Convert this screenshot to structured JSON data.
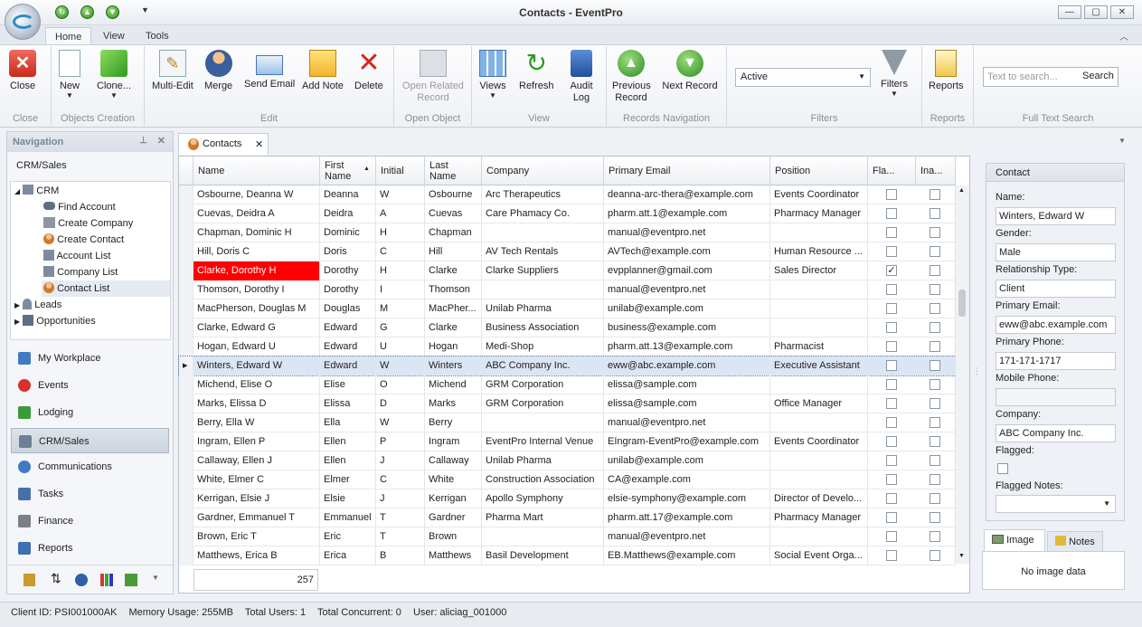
{
  "window": {
    "title": "Contacts - EventPro"
  },
  "ribbon": {
    "tabs": [
      "Home",
      "View",
      "Tools"
    ],
    "groups": [
      {
        "label": "Close",
        "buttons": [
          "Close"
        ]
      },
      {
        "label": "Objects Creation",
        "buttons": [
          "New",
          "Clone..."
        ]
      },
      {
        "label": "Edit",
        "buttons": [
          "Multi-Edit",
          "Merge",
          "Send Email",
          "Add Note",
          "Delete"
        ]
      },
      {
        "label": "Open Object",
        "buttons": [
          "Open Related Record"
        ]
      },
      {
        "label": "View",
        "buttons": [
          "Views",
          "Refresh",
          "Audit Log"
        ]
      },
      {
        "label": "Records Navigation",
        "buttons": [
          "Previous Record",
          "Next Record"
        ]
      },
      {
        "label": "Filters",
        "buttons": [
          "Filters"
        ]
      },
      {
        "label": "Reports",
        "buttons": [
          "Reports"
        ]
      },
      {
        "label": "Full Text Search",
        "buttons": [
          "Search"
        ]
      }
    ],
    "filter_value": "Active",
    "search_placeholder": "Text to search...",
    "search_button": "Search"
  },
  "nav": {
    "header": "Navigation",
    "section": "CRM/Sales",
    "tree": {
      "root": "CRM",
      "children": [
        "Find Account",
        "Create Company",
        "Create Contact",
        "Account List",
        "Company List",
        "Contact List"
      ],
      "others": [
        "Leads",
        "Opportunities"
      ]
    },
    "modules": [
      "My Workplace",
      "Events",
      "Lodging",
      "CRM/Sales",
      "Communications",
      "Tasks",
      "Finance",
      "Reports"
    ],
    "selected_module": "CRM/Sales"
  },
  "doc_tab": "Contacts",
  "grid": {
    "columns": [
      "Name",
      "First Name",
      "Initial",
      "Last Name",
      "Company",
      "Primary Email",
      "Position",
      "Fla...",
      "Ina..."
    ],
    "rows": [
      [
        "Osbourne, Deanna W",
        "Deanna",
        "W",
        "Osbourne",
        "Arc Therapeutics",
        "deanna-arc-thera@example.com",
        "Events Coordinator",
        false
      ],
      [
        "Cuevas, Deidra A",
        "Deidra",
        "A",
        "Cuevas",
        "Care Phamacy Co.",
        "pharm.att.1@example.com",
        "Pharmacy Manager",
        false
      ],
      [
        "Chapman, Dominic H",
        "Dominic",
        "H",
        "Chapman",
        "",
        "manual@eventpro.net",
        "",
        false
      ],
      [
        "Hill, Doris C",
        "Doris",
        "C",
        "Hill",
        "AV Tech Rentals",
        "AVTech@example.com",
        "Human Resource ...",
        false
      ],
      [
        "Clarke, Dorothy H",
        "Dorothy",
        "H",
        "Clarke",
        "Clarke Suppliers",
        "evpplanner@gmail.com",
        "Sales Director",
        true
      ],
      [
        "Thomson, Dorothy I",
        "Dorothy",
        "I",
        "Thomson",
        "",
        "manual@eventpro.net",
        "",
        false
      ],
      [
        "MacPherson, Douglas M",
        "Douglas",
        "M",
        "MacPher...",
        "Unilab Pharma",
        "unilab@example.com",
        "",
        false
      ],
      [
        "Clarke, Edward G",
        "Edward",
        "G",
        "Clarke",
        "Business Association",
        "business@example.com",
        "",
        false
      ],
      [
        "Hogan, Edward U",
        "Edward",
        "U",
        "Hogan",
        "Medi-Shop",
        "pharm.att.13@example.com",
        "Pharmacist",
        false
      ],
      [
        "Winters, Edward W",
        "Edward",
        "W",
        "Winters",
        "ABC Company Inc.",
        "eww@abc.example.com",
        "Executive Assistant",
        false
      ],
      [
        "Michend, Elise O",
        "Elise",
        "O",
        "Michend",
        "GRM Corporation",
        "elissa@sample.com",
        "",
        false
      ],
      [
        "Marks, Elissa D",
        "Elissa",
        "D",
        "Marks",
        "GRM Corporation",
        "elissa@sample.com",
        "Office Manager",
        false
      ],
      [
        "Berry, Ella W",
        "Ella",
        "W",
        "Berry",
        "",
        "manual@eventpro.net",
        "",
        false
      ],
      [
        "Ingram, Ellen P",
        "Ellen",
        "P",
        "Ingram",
        "EventPro Internal Venue",
        "EIngram-EventPro@example.com",
        "Events Coordinator",
        false
      ],
      [
        "Callaway, Ellen J",
        "Ellen",
        "J",
        "Callaway",
        "Unilab Pharma",
        "unilab@example.com",
        "",
        false
      ],
      [
        "White, Elmer C",
        "Elmer",
        "C",
        "White",
        "Construction Association",
        "CA@example.com",
        "",
        false
      ],
      [
        "Kerrigan, Elsie J",
        "Elsie",
        "J",
        "Kerrigan",
        "Apollo Symphony",
        "elsie-symphony@example.com",
        "Director of Develo...",
        false
      ],
      [
        "Gardner, Emmanuel T",
        "Emmanuel",
        "T",
        "Gardner",
        "Pharma Mart",
        "pharm.att.17@example.com",
        "Pharmacy Manager",
        false
      ],
      [
        "Brown, Eric T",
        "Eric",
        "T",
        "Brown",
        "",
        "manual@eventpro.net",
        "",
        false
      ],
      [
        "Matthews, Erica B",
        "Erica",
        "B",
        "Matthews",
        "Basil Development",
        "EB.Matthews@example.com",
        "Social Event Orga...",
        false
      ]
    ],
    "count": "257"
  },
  "contact": {
    "title": "Contact",
    "name_label": "Name:",
    "name": "Winters, Edward W",
    "gender_label": "Gender:",
    "gender": "Male",
    "rel_label": "Relationship Type:",
    "rel": "Client",
    "email_label": "Primary Email:",
    "email": "eww@abc.example.com",
    "phone_label": "Primary Phone:",
    "phone": "171-171-1717",
    "mobile_label": "Mobile Phone:",
    "mobile": "",
    "company_label": "Company:",
    "company": "ABC Company Inc.",
    "flagged_label": "Flagged:",
    "notes_label": "Flagged Notes:",
    "tab_image": "Image",
    "tab_notes": "Notes",
    "no_image": "No image data"
  },
  "status": {
    "client": "Client ID: PSI001000AK",
    "memory": "Memory Usage: 255MB",
    "users": "Total Users: 1",
    "concurrent": "Total Concurrent: 0",
    "user": "User: aliciag_001000"
  },
  "colors": {
    "flag_red": "#ff0000",
    "selected_row": "#dbe6f4",
    "accent": "#2d8a23"
  }
}
